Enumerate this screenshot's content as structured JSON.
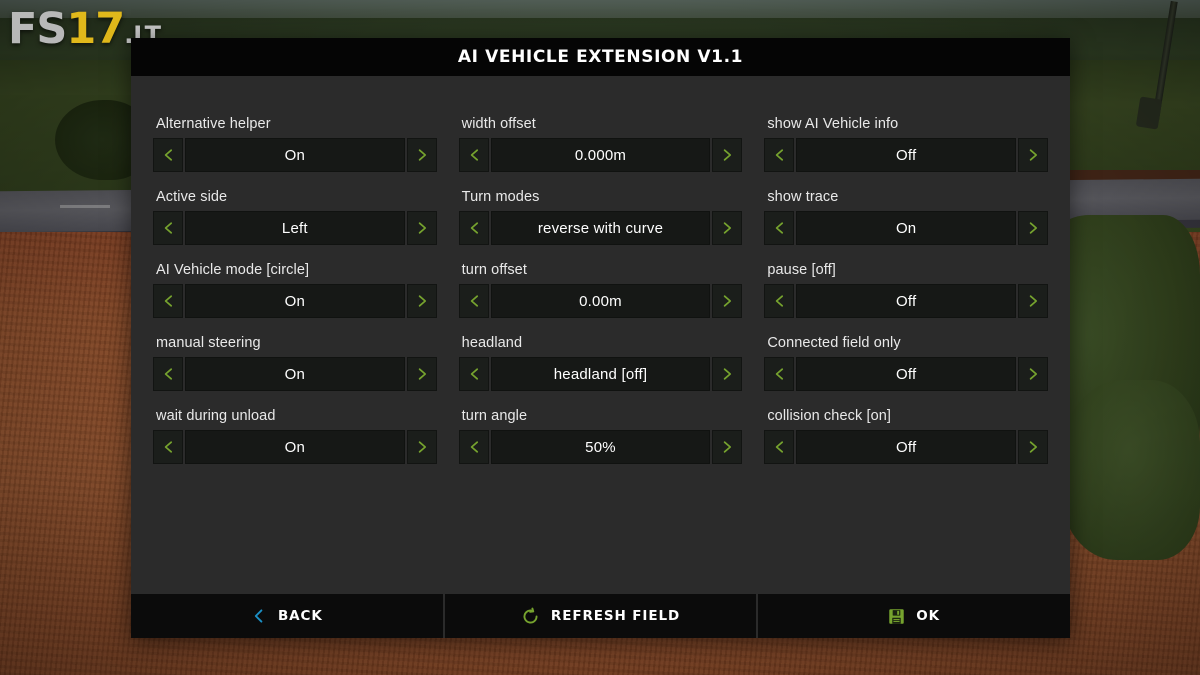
{
  "watermark": {
    "fs": "FS",
    "number": "17",
    "tld": ".LT"
  },
  "dialog": {
    "title": "AI VEHICLE EXTENSION V1.1"
  },
  "colors": {
    "panel_bg": "#2b2b2b",
    "title_bg": "#050505",
    "arrow_green": "#76a32e",
    "back_blue": "#1b8fc4",
    "value_bg": "#161816",
    "footer_bg": "#0b0b0b",
    "watermark_yellow": "#e0b81b"
  },
  "settings": [
    {
      "label": "Alternative helper",
      "value": "On",
      "prev_icon": "chevron-left-icon",
      "next_icon": "chevron-right-icon"
    },
    {
      "label": "width offset",
      "value": "0.000m",
      "prev_icon": "chevron-left-icon",
      "next_icon": "chevron-right-icon"
    },
    {
      "label": "show AI Vehicle info",
      "value": "Off",
      "prev_icon": "chevron-left-icon",
      "next_icon": "chevron-right-icon"
    },
    {
      "label": "Active side",
      "value": "Left",
      "prev_icon": "chevron-left-icon",
      "next_icon": "chevron-right-icon"
    },
    {
      "label": "Turn modes",
      "value": "reverse with curve",
      "prev_icon": "chevron-left-icon",
      "next_icon": "chevron-right-icon"
    },
    {
      "label": "show trace",
      "value": "On",
      "prev_icon": "chevron-left-icon",
      "next_icon": "chevron-right-icon"
    },
    {
      "label": "AI Vehicle mode [circle]",
      "value": "On",
      "prev_icon": "chevron-left-icon",
      "next_icon": "chevron-right-icon"
    },
    {
      "label": "turn offset",
      "value": "0.00m",
      "prev_icon": "chevron-left-icon",
      "next_icon": "chevron-right-icon"
    },
    {
      "label": "pause [off]",
      "value": "Off",
      "prev_icon": "chevron-left-icon",
      "next_icon": "chevron-right-icon"
    },
    {
      "label": "manual steering",
      "value": "On",
      "prev_icon": "chevron-left-icon",
      "next_icon": "chevron-right-icon"
    },
    {
      "label": "headland",
      "value": "headland [off]",
      "prev_icon": "chevron-left-icon",
      "next_icon": "chevron-right-icon"
    },
    {
      "label": "Connected field only",
      "value": "Off",
      "prev_icon": "chevron-left-icon",
      "next_icon": "chevron-right-icon"
    },
    {
      "label": "wait during unload",
      "value": "On",
      "prev_icon": "chevron-left-icon",
      "next_icon": "chevron-right-icon"
    },
    {
      "label": "turn angle",
      "value": "50%",
      "prev_icon": "chevron-left-icon",
      "next_icon": "chevron-right-icon"
    },
    {
      "label": "collision check [on]",
      "value": "Off",
      "prev_icon": "chevron-left-icon",
      "next_icon": "chevron-right-icon"
    }
  ],
  "footer": {
    "buttons": [
      {
        "label": "BACK",
        "icon": "chevron-left-icon",
        "icon_color": "#1b8fc4"
      },
      {
        "label": "REFRESH FIELD",
        "icon": "refresh-circle-icon",
        "icon_color": "#76a32e"
      },
      {
        "label": "OK",
        "icon": "save-floppy-icon",
        "icon_color": "#76a32e"
      }
    ]
  }
}
